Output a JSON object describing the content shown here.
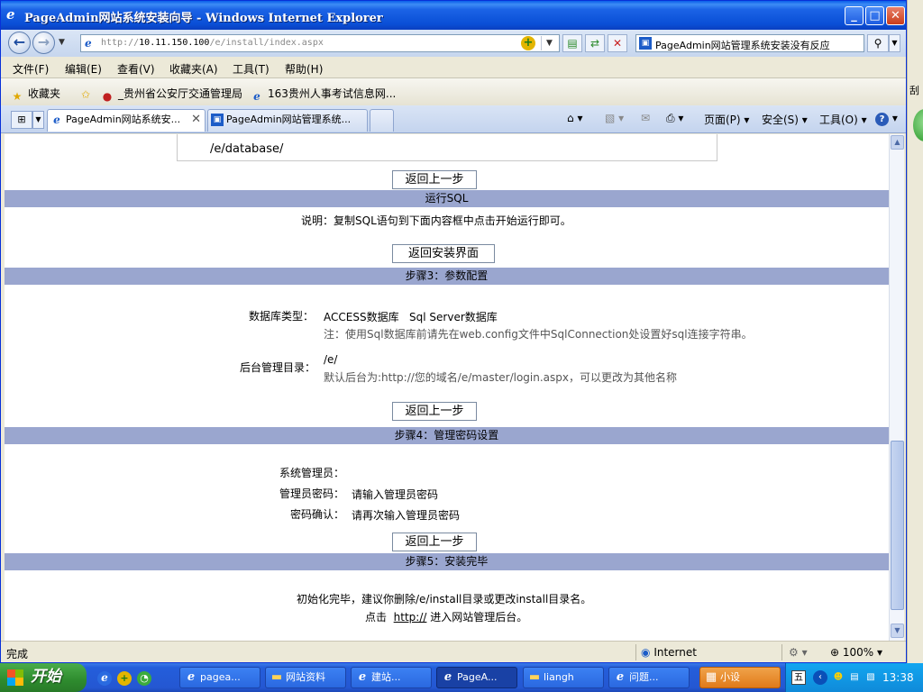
{
  "window": {
    "title": "PageAdmin网站系统安装向导 - Windows Internet Explorer",
    "minimize": "_",
    "maximize": "□",
    "close": "✕"
  },
  "address_bar": {
    "url_prefix": "http://",
    "url_host": "10.11.150.100",
    "url_path": "/e/install/index.aspx",
    "search_text": "PageAdmin网站管理系统安装没有反应"
  },
  "menu": [
    "文件(F)",
    "编辑(E)",
    "查看(V)",
    "收藏夹(A)",
    "工具(T)",
    "帮助(H)"
  ],
  "favorites_bar": {
    "favorites_label": "收藏夹",
    "links": [
      "_贵州省公安厅交通管理局",
      "163贵州人事考试信息网..."
    ]
  },
  "tabs": [
    {
      "title": "PageAdmin网站系统安...",
      "active": true
    },
    {
      "title": "PageAdmin网站管理系统...",
      "active": false
    }
  ],
  "command_bar": {
    "page": "页面(P)",
    "safety": "安全(S)",
    "tools": "工具(O)"
  },
  "content": {
    "db_path": "/e/database/",
    "back_button_1": "返回上一步",
    "run_sql_header": "运行SQL",
    "run_sql_note": "说明：复制SQL语句到下面内容框中点击开始运行即可。",
    "back_install_button": "返回安装界面",
    "step3_header": "步骤3：参数配置",
    "db_type_label": "数据库类型：",
    "db_type_options": [
      "ACCESS数据库",
      "Sql Server数据库"
    ],
    "db_type_note": "注：使用Sql数据库前请先在web.config文件中SqlConnection处设置好sql连接字符串。",
    "admin_dir_label": "后台管理目录：",
    "admin_dir_value": "/e/",
    "admin_dir_note": "默认后台为:http://您的域名/e/master/login.aspx，可以更改为其他名称",
    "back_button_2": "返回上一步",
    "step4_header": "步骤4：管理密码设置",
    "sys_admin_label": "系统管理员：",
    "admin_pwd_label": "管理员密码：",
    "admin_pwd_placeholder": "请输入管理员密码",
    "confirm_pwd_label": "密码确认：",
    "confirm_pwd_placeholder": "请再次输入管理员密码",
    "back_button_3": "返回上一步",
    "step5_header": "步骤5：安装完毕",
    "done_note": "初始化完毕，建议你删除/e/install目录或更改install目录名。",
    "click_prefix": "点击",
    "click_link": "http://",
    "click_suffix": "进入网站管理后台。"
  },
  "status_bar": {
    "status": "完成",
    "zone": "Internet",
    "zoom": "100%"
  },
  "right_strip_char": "刮",
  "taskbar": {
    "start": "开始",
    "tasks": [
      {
        "label": "pagea...",
        "icon": "ie-icon"
      },
      {
        "label": "网站资料",
        "icon": "folder-icon"
      },
      {
        "label": "建站...",
        "icon": "ie-icon"
      },
      {
        "label": "PageA...",
        "icon": "ie-icon",
        "active": true
      },
      {
        "label": "liangh",
        "icon": "folder-icon"
      },
      {
        "label": "问题...",
        "icon": "ie-icon"
      },
      {
        "label": "小设",
        "icon": "paint-icon",
        "highlight": true
      }
    ],
    "tray_ime": "五",
    "clock": "13:38"
  }
}
